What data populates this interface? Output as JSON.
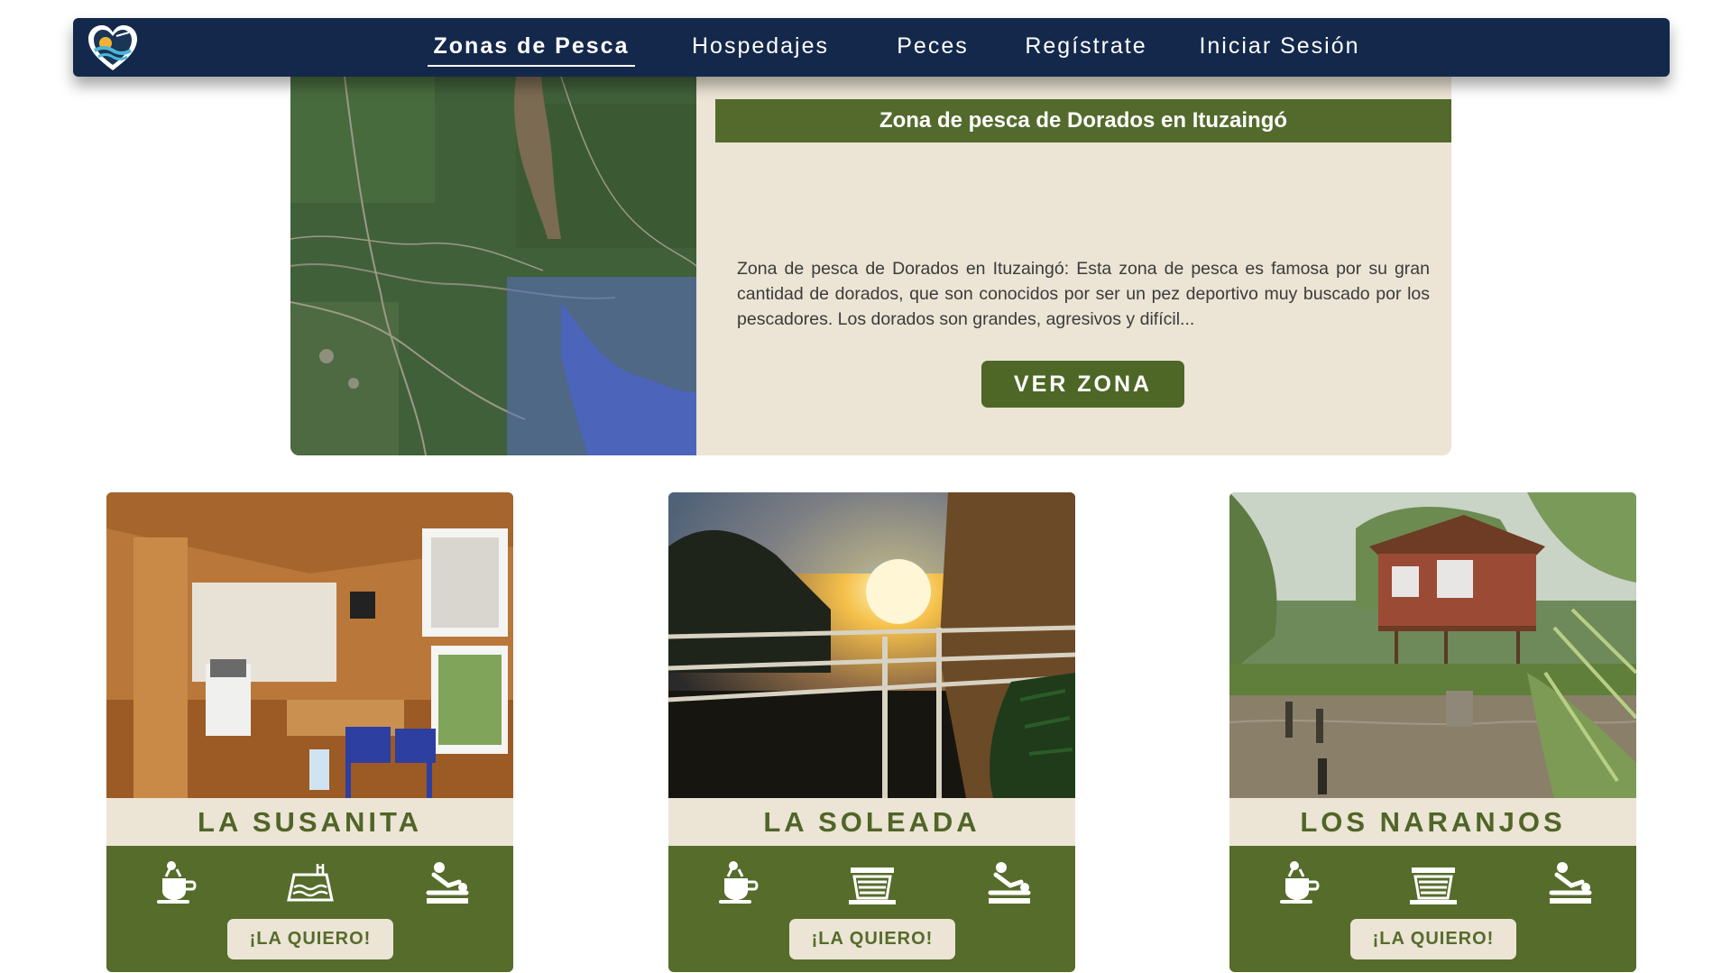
{
  "nav": {
    "logo_icon": "heart-fishing-logo-icon",
    "items": [
      {
        "label": "Zonas de Pesca",
        "active": true
      },
      {
        "label": "Hospedajes"
      },
      {
        "label": "Peces"
      },
      {
        "label": "Regístrate"
      },
      {
        "label": "Iniciar Sesión"
      }
    ]
  },
  "zone": {
    "title": "Zona de pesca de Dorados en Ituzaingó",
    "description": "Zona de pesca de Dorados en Ituzaingó: Esta zona de pesca es famosa por su gran cantidad de dorados, que son conocidos por ser un pez deportivo muy buscado por los pescadores. Los dorados son grandes, agresivos y difícil...",
    "button_label": "VER ZONA",
    "map_icon": "satellite-map-image"
  },
  "lodgings": [
    {
      "name": "LA SUSANITA",
      "button_label": "¡LA QUIERO!",
      "amenities": [
        "hot-drink-icon",
        "pool-icon",
        "massage-icon"
      ]
    },
    {
      "name": "LA SOLEADA",
      "button_label": "¡LA QUIERO!",
      "amenities": [
        "hot-drink-icon",
        "grill-icon",
        "massage-icon"
      ]
    },
    {
      "name": "LOS NARANJOS",
      "button_label": "¡LA QUIERO!",
      "amenities": [
        "hot-drink-icon",
        "grill-icon",
        "massage-icon"
      ]
    }
  ],
  "colors": {
    "nav_bg": "#14284b",
    "olive": "#556c2b",
    "beige": "#ece4d5"
  }
}
